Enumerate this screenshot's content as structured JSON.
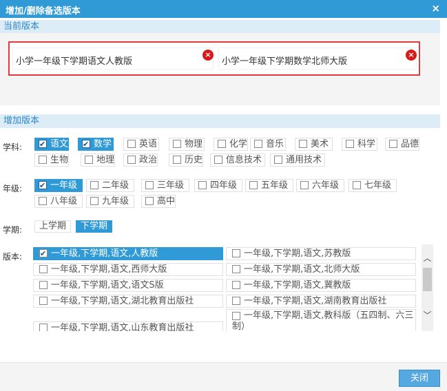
{
  "dialog": {
    "title": "增加/删除备选版本",
    "close_glyph": "×"
  },
  "current": {
    "header": "当前版本",
    "items": [
      {
        "label": "小学一年级下学期语文人教版"
      },
      {
        "label": "小学一年级下学期数学北师大版"
      }
    ],
    "delete_glyph": "×"
  },
  "add": {
    "header": "增加版本",
    "subject_label": "学科:",
    "subjects": [
      {
        "label": "语文",
        "checked": true
      },
      {
        "label": "数学",
        "checked": true
      },
      {
        "label": "英语",
        "checked": false
      },
      {
        "label": "物理",
        "checked": false
      },
      {
        "label": "化学",
        "checked": false
      },
      {
        "label": "音乐",
        "checked": false
      },
      {
        "label": "美术",
        "checked": false
      },
      {
        "label": "科学",
        "checked": false
      },
      {
        "label": "品德",
        "checked": false
      },
      {
        "label": "生物",
        "checked": false
      },
      {
        "label": "地理",
        "checked": false
      },
      {
        "label": "政治",
        "checked": false
      },
      {
        "label": "历史",
        "checked": false
      },
      {
        "label": "信息技术",
        "checked": false
      },
      {
        "label": "通用技术",
        "checked": false
      }
    ],
    "grade_label": "年级:",
    "grades": [
      {
        "label": "一年级",
        "checked": true
      },
      {
        "label": "二年级",
        "checked": false
      },
      {
        "label": "三年级",
        "checked": false
      },
      {
        "label": "四年级",
        "checked": false
      },
      {
        "label": "五年级",
        "checked": false
      },
      {
        "label": "六年级",
        "checked": false
      },
      {
        "label": "七年级",
        "checked": false
      },
      {
        "label": "八年级",
        "checked": false
      },
      {
        "label": "九年级",
        "checked": false
      },
      {
        "label": "高中",
        "checked": false
      }
    ],
    "term_label": "学期:",
    "terms": [
      {
        "label": "上学期",
        "selected": false
      },
      {
        "label": "下学期",
        "selected": true
      }
    ],
    "version_label": "版本:",
    "versions": [
      {
        "label": "一年级,下学期,语文,人教版",
        "checked": true
      },
      {
        "label": "一年级,下学期,语文,苏教版",
        "checked": false
      },
      {
        "label": "一年级,下学期,语文,西师大版",
        "checked": false
      },
      {
        "label": "一年级,下学期,语文,北师大版",
        "checked": false
      },
      {
        "label": "一年级,下学期,语文,语文S版",
        "checked": false
      },
      {
        "label": "一年级,下学期,语文,冀教版",
        "checked": false
      },
      {
        "label": "一年级,下学期,语文,湖北教育出版社",
        "checked": false
      },
      {
        "label": "一年级,下学期,语文,湖南教育出版社",
        "checked": false
      },
      {
        "label": "一年级,下学期,语文,山东教育出版社",
        "checked": false
      },
      {
        "label": "一年级,下学期,语文,教科版（五四制、六三制）",
        "checked": false
      }
    ],
    "scroll_up_glyph": "︿",
    "scroll_down_glyph": "﹀"
  },
  "footer": {
    "close_label": "关闭"
  },
  "colors": {
    "accent": "#2f9ad6",
    "section_bg": "#dcedf8",
    "danger": "#d61b1b"
  }
}
